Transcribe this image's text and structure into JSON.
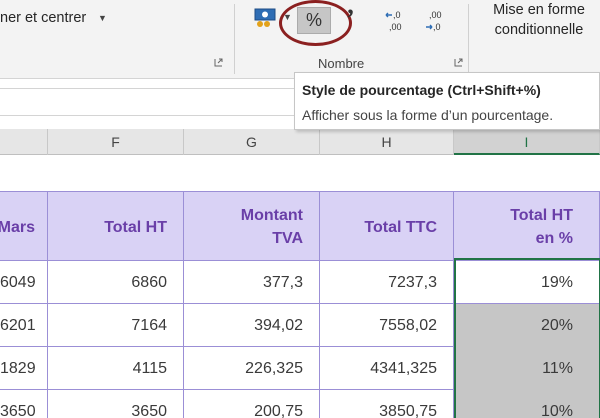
{
  "ribbon": {
    "merge_center_label": "ner et centrer",
    "number_group_label": "Nombre",
    "percent_label": "%",
    "comma_label": "’",
    "conditional_format_label_line1": "Mise en forme",
    "conditional_format_label_line2": "conditionnelle",
    "increase_decimal_top": ",0",
    "increase_decimal_bottom": ",00",
    "decrease_decimal_top": ",00",
    "decrease_decimal_bottom": ",0"
  },
  "tooltip": {
    "title": "Style de pourcentage (Ctrl+Shift+%)",
    "description": "Afficher sous la forme d’un pourcentage."
  },
  "columns": [
    "F",
    "G",
    "H",
    "I"
  ],
  "table": {
    "headers": {
      "e": "Mars",
      "f": "Total HT",
      "g1": "Montant",
      "g2": "TVA",
      "h": "Total TTC",
      "i1": "Total HT",
      "i2": "en %"
    },
    "rows": [
      {
        "e": "6049",
        "f": "6860",
        "g": "377,3",
        "h": "7237,3",
        "i": "19%"
      },
      {
        "e": "6201",
        "f": "7164",
        "g": "394,02",
        "h": "7558,02",
        "i": "20%"
      },
      {
        "e": "1829",
        "f": "4115",
        "g": "226,325",
        "h": "4341,325",
        "i": "11%"
      },
      {
        "e": "3650",
        "f": "3650",
        "g": "200,75",
        "h": "3850,75",
        "i": "10%"
      }
    ]
  },
  "colors": {
    "header_fill": "#d9d2f5",
    "header_text": "#6a3fa8",
    "selection_border": "#217346",
    "highlight_circle": "#8b2020"
  }
}
